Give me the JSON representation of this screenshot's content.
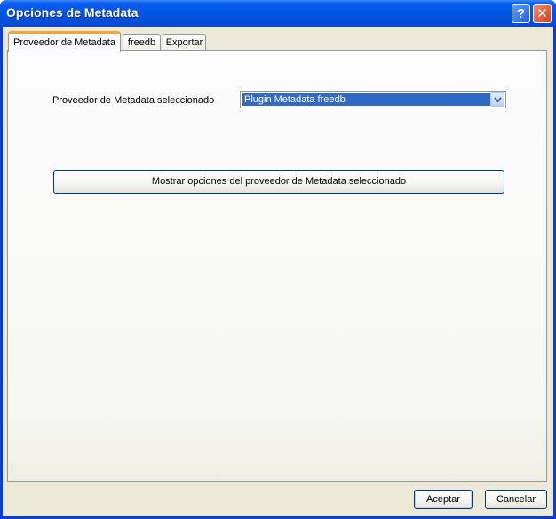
{
  "window": {
    "title": "Opciones de Metadata",
    "help_glyph": "?",
    "close_glyph": "✕"
  },
  "tabs": [
    {
      "label": "Proveedor de Metadata",
      "active": true
    },
    {
      "label": "freedb",
      "active": false
    },
    {
      "label": "Exportar",
      "active": false
    }
  ],
  "provider": {
    "label": "Proveedor de Metadata seleccionado",
    "selected": "Plugin Metadata freedb"
  },
  "show_options_button": "Mostrar opciones del proveedor de Metadata seleccionado",
  "footer": {
    "accept": "Aceptar",
    "cancel": "Cancelar"
  },
  "colors": {
    "titlebar": "#0455e6",
    "selection": "#316ac5",
    "tab_highlight": "#f2a53a",
    "dialog_bg": "#ece9d8"
  }
}
